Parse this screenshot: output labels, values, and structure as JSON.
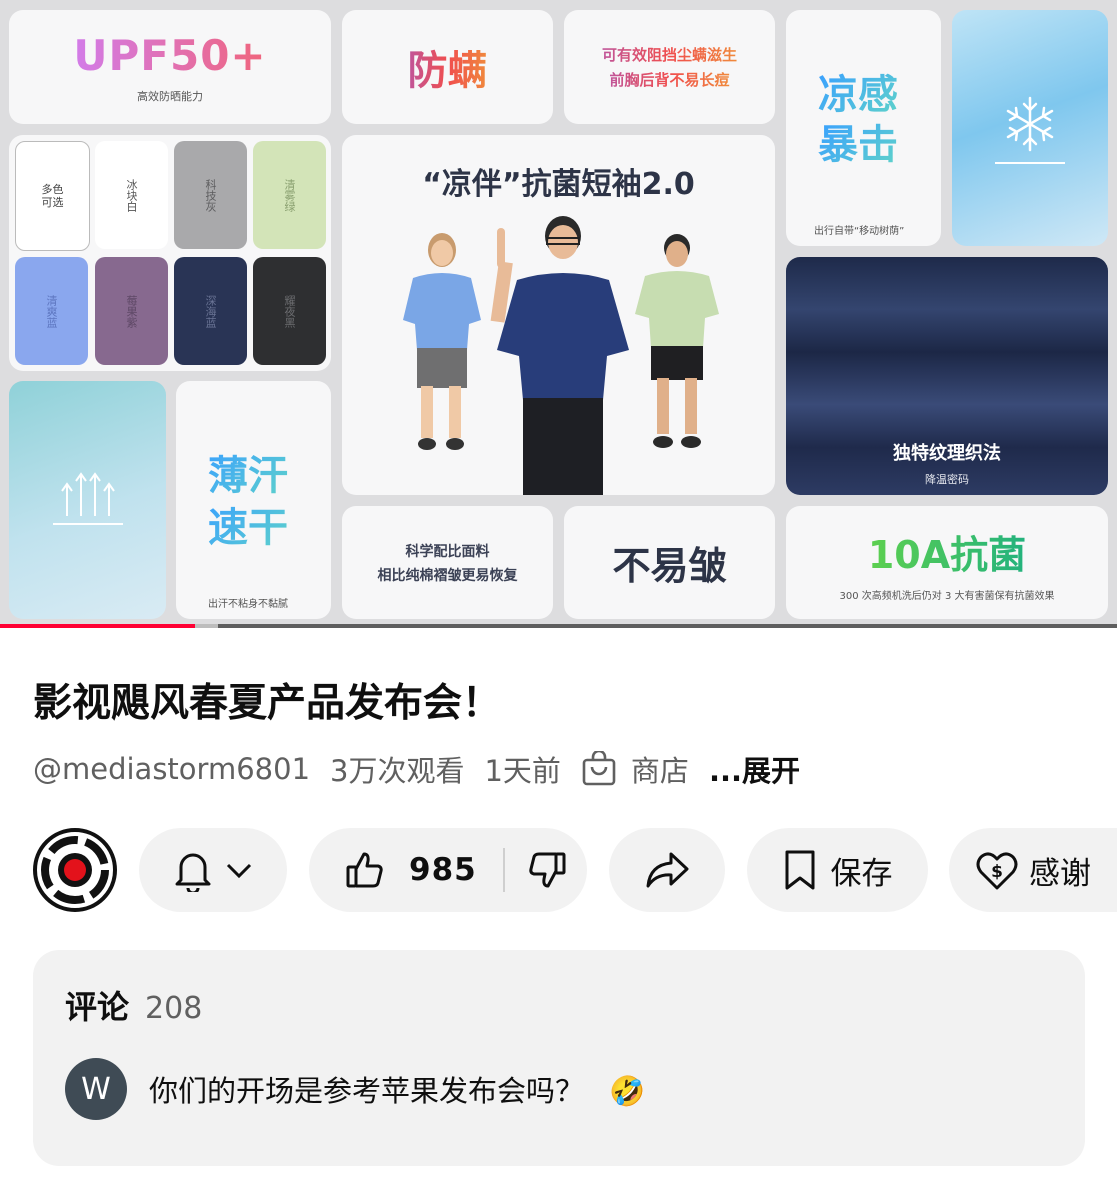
{
  "video": {
    "upf_title": "UPF50+",
    "upf_sub": "高效防晒能力",
    "anti_mite_title": "防螨",
    "anti_mite_desc_1": "可有效阻挡尘螨滋生",
    "anti_mite_desc_2": "前胸后背不易长痘",
    "cool_title_1": "凉感",
    "cool_title_2": "暴击",
    "cool_sub": "出行自带“移动树荫”",
    "product_title": "“凉伴”抗菌短袖2.0",
    "swatches": [
      {
        "label": "多色可选",
        "color": "#ffffff"
      },
      {
        "label": "冰块白",
        "color": "#ffffff"
      },
      {
        "label": "科技灰",
        "color": "#a9a9ab"
      },
      {
        "label": "清雾绿",
        "color": "#d3e4b8"
      },
      {
        "label": "清爽蓝",
        "color": "#8aa7ee"
      },
      {
        "label": "莓果紫",
        "color": "#87698f"
      },
      {
        "label": "深海蓝",
        "color": "#293455"
      },
      {
        "label": "耀夜黑",
        "color": "#2e2f31"
      }
    ],
    "texture_title": "独特纹理织法",
    "texture_sub": "降温密码",
    "sweat_title_1": "薄汗",
    "sweat_title_2": "速干",
    "sweat_sub": "出汗不粘身不黏腻",
    "fabric_desc_1": "科学配比面料",
    "fabric_desc_2": "相比纯棉褶皱更易恢复",
    "wrinkle_title": "不易皱",
    "antibac_title": "10A抗菌",
    "antibac_sub": "300 次高频机洗后仍对 3 大有害菌保有抗菌效果",
    "progress": 0.175,
    "buffered": 0.195
  },
  "details": {
    "title": "影视飓风春夏产品发布会！",
    "channel": "@mediastorm6801",
    "views": "3万次观看",
    "age": "1天前",
    "shop_label": "商店",
    "expand_label": "...展开"
  },
  "actions": {
    "like_count": "985",
    "save_label": "保存",
    "thanks_label": "感谢"
  },
  "comments": {
    "header": "评论",
    "count": "208",
    "top_comment": {
      "avatar_letter": "W",
      "text": "你们的开场是参考苹果发布会吗？",
      "emoji": "🤣"
    }
  },
  "colors": {
    "progress_red": "#ff0033",
    "pill_bg": "#f2f2f2",
    "avatar_bg": "#3f4b55"
  }
}
